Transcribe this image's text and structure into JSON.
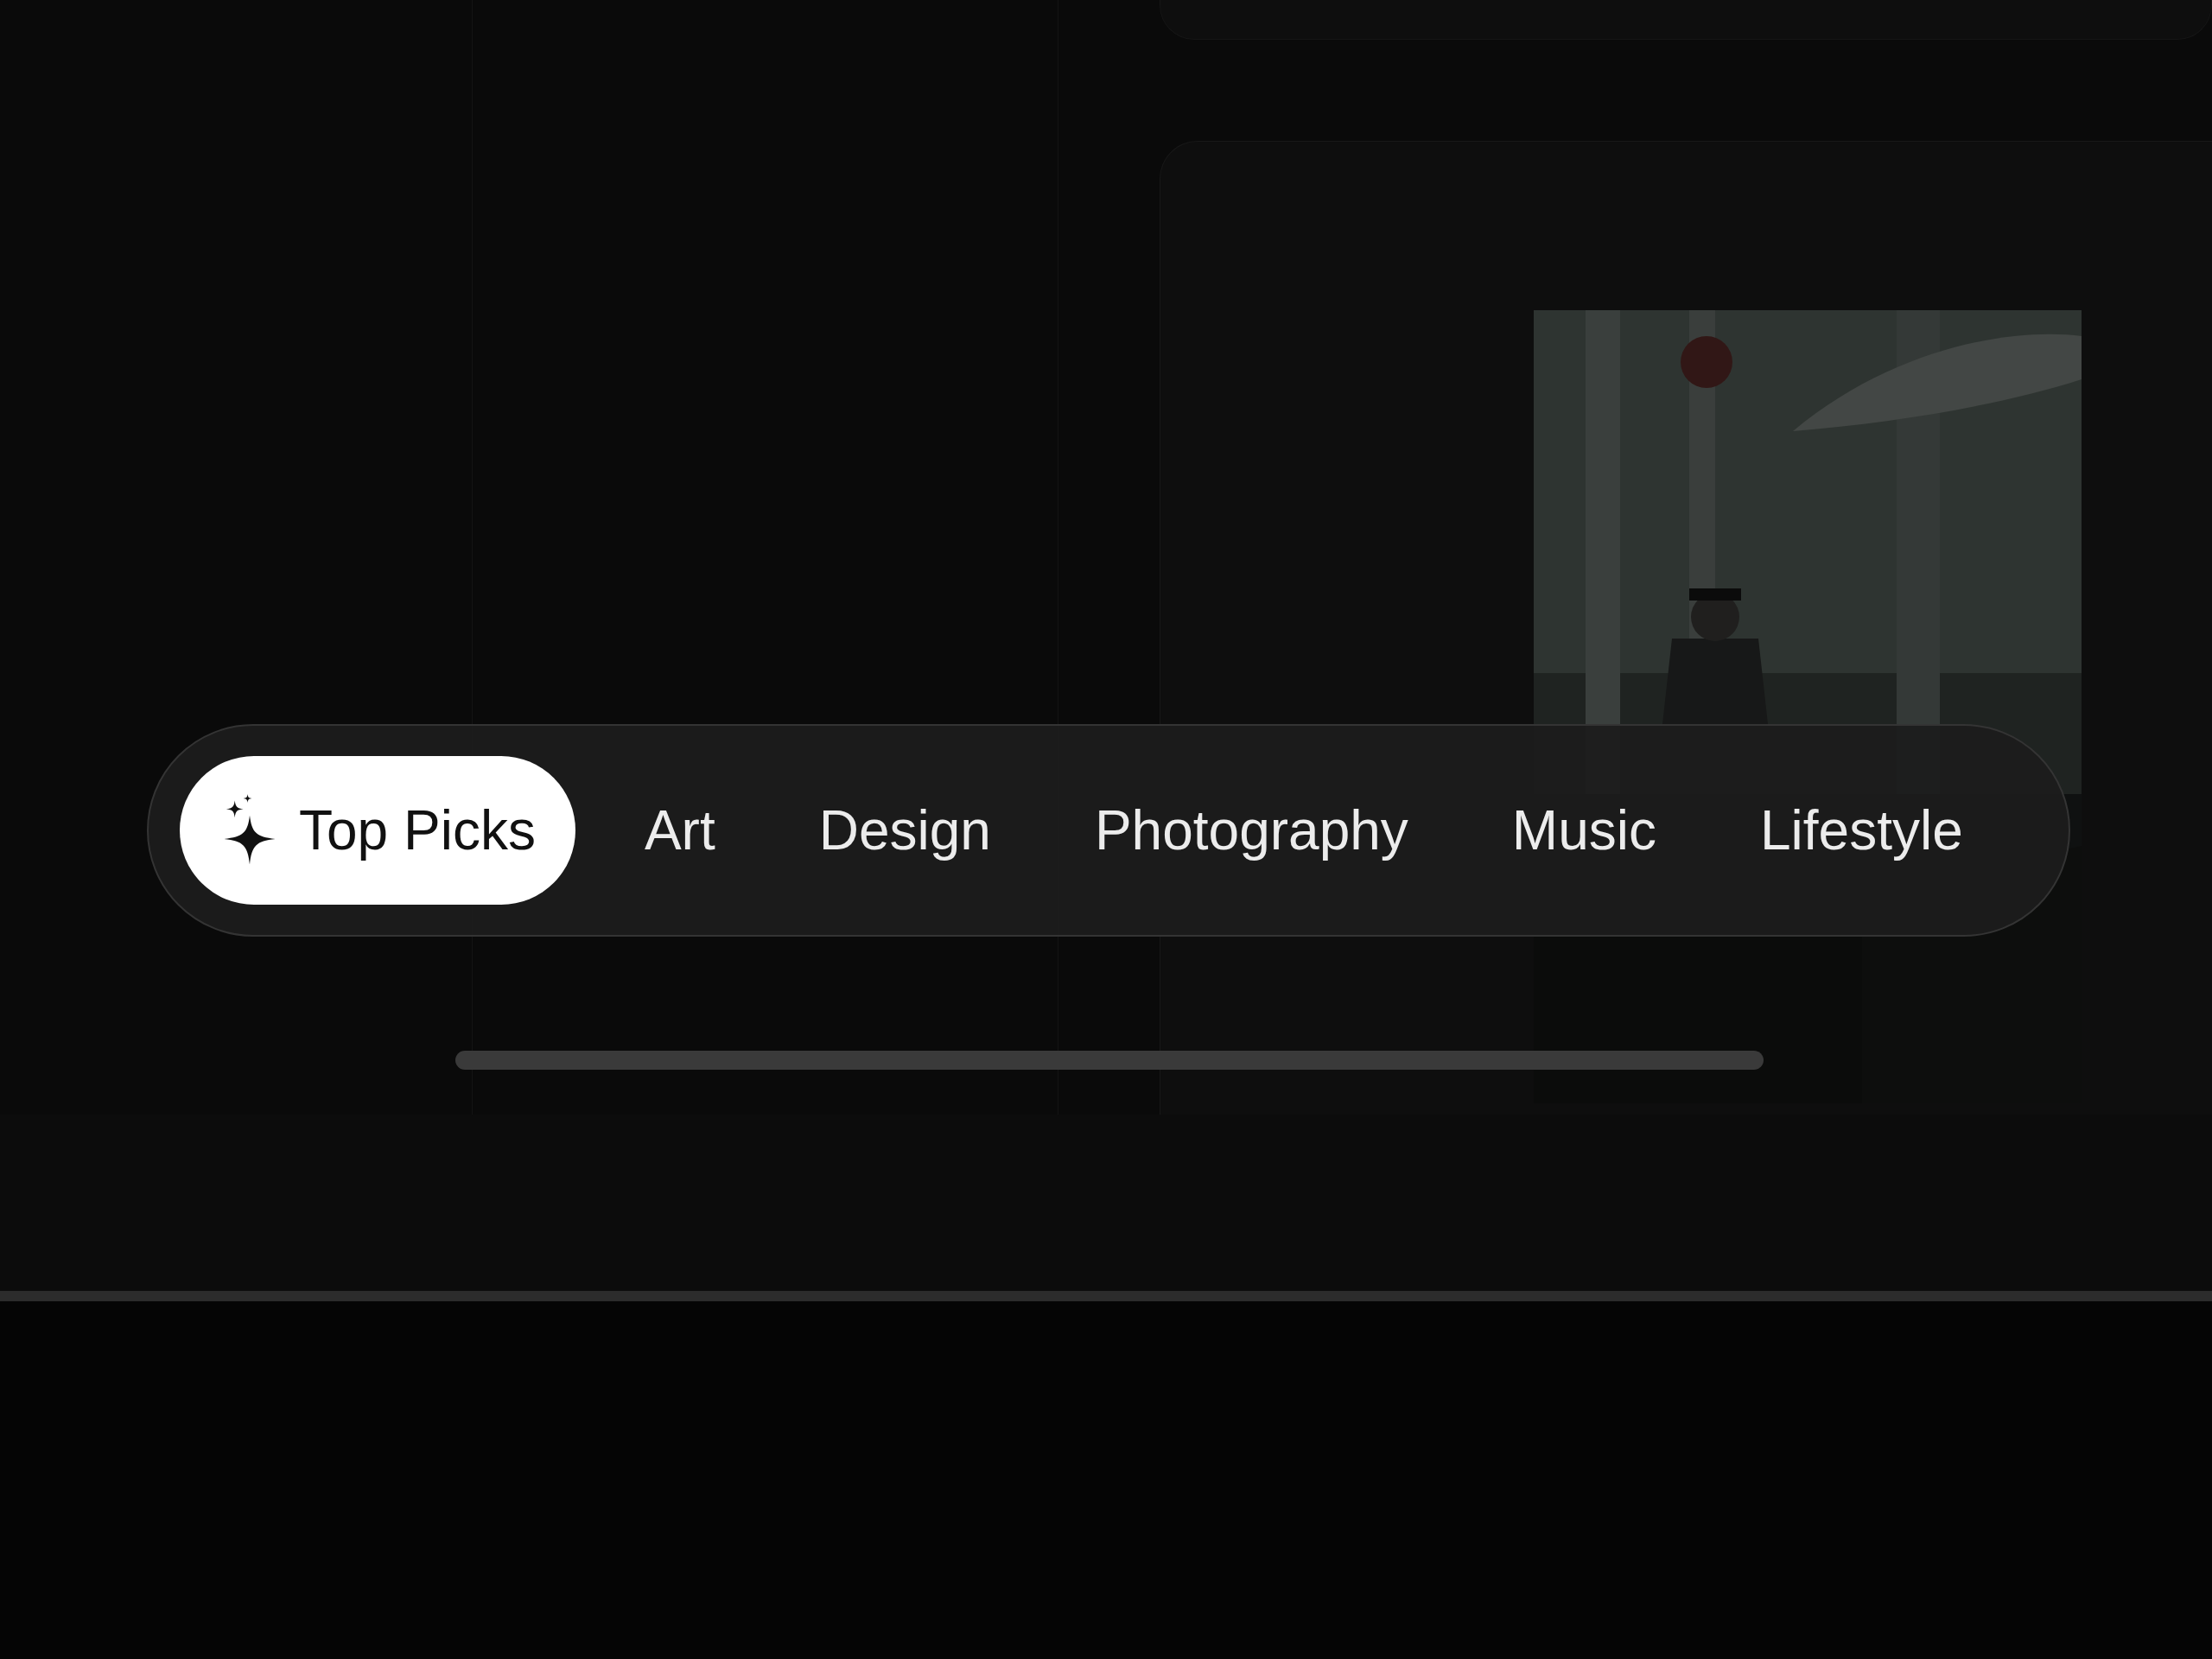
{
  "categories": [
    {
      "label": "Top Picks",
      "selected": true,
      "kind": "featured"
    },
    {
      "label": "Art",
      "selected": false,
      "kind": "plain"
    },
    {
      "label": "Design",
      "selected": false,
      "kind": "plain"
    },
    {
      "label": "Photography",
      "selected": false,
      "kind": "plain"
    },
    {
      "label": "Music",
      "selected": false,
      "kind": "plain"
    },
    {
      "label": "Lifestyle",
      "selected": false,
      "kind": "plain"
    }
  ]
}
